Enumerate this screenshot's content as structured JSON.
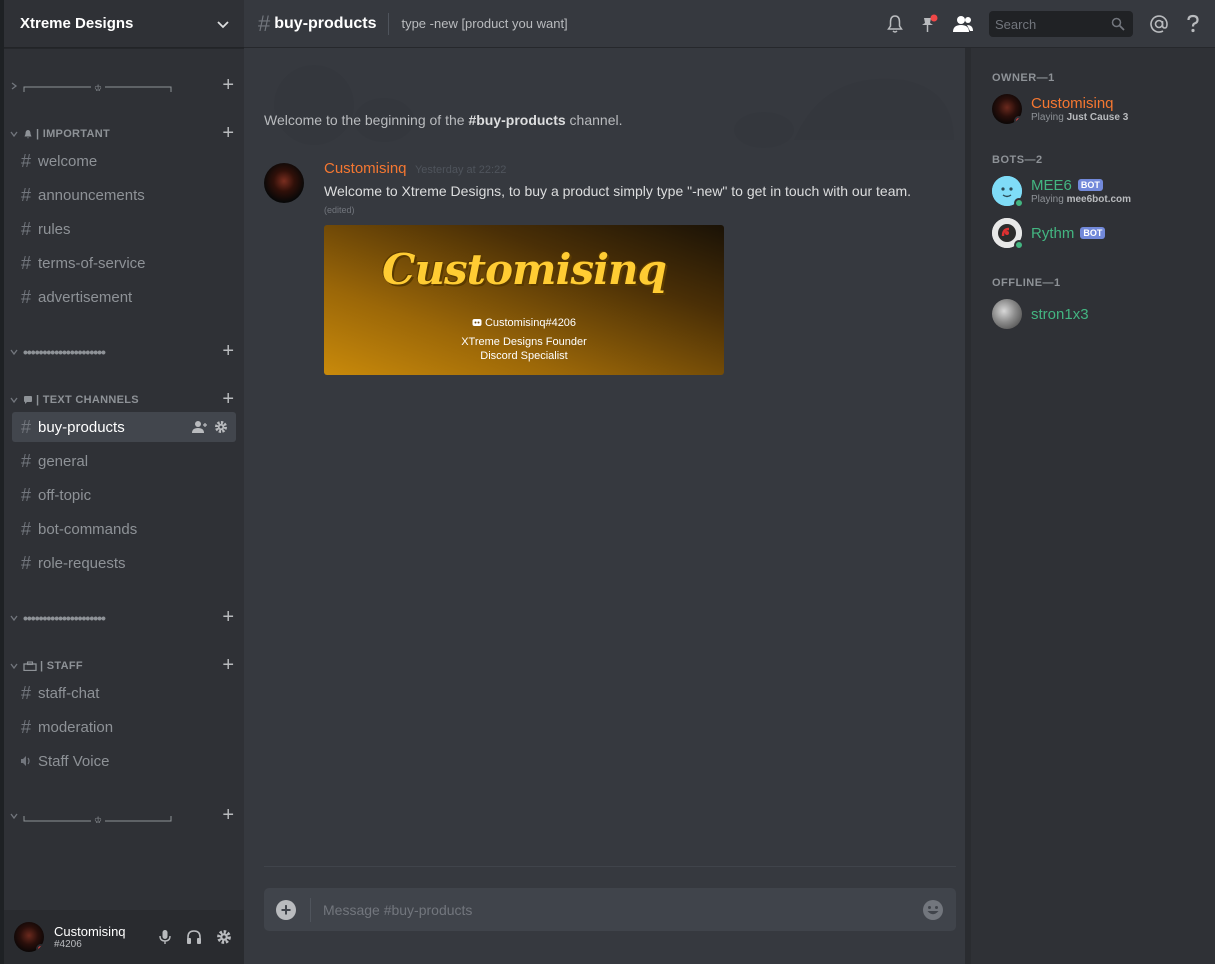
{
  "guild": {
    "name": "Xtreme Designs"
  },
  "categories": {
    "divider_top": {
      "label": ""
    },
    "important": {
      "label": "| IMPORTANT"
    },
    "dots_1": {
      "label": "•••••••••••••••••••••"
    },
    "text_channels": {
      "label": "| TEXT CHANNELS"
    },
    "dots_2": {
      "label": "•••••••••••••••••••••"
    },
    "staff": {
      "label": "| STAFF"
    },
    "divider_bottom": {
      "label": ""
    }
  },
  "channels": {
    "important": [
      "welcome",
      "announcements",
      "rules",
      "terms-of-service",
      "advertisement"
    ],
    "text": [
      "buy-products",
      "general",
      "off-topic",
      "bot-commands",
      "role-requests"
    ],
    "staff": [
      "staff-chat",
      "moderation",
      "Staff Voice"
    ]
  },
  "current_channel": {
    "name": "buy-products",
    "topic": "type -new [product you want]"
  },
  "search": {
    "placeholder": "Search"
  },
  "welcome": {
    "prefix": "Welcome to the beginning of the ",
    "channel": "#buy-products",
    "suffix": " channel."
  },
  "message": {
    "author": "Customisinq",
    "timestamp": "Yesterday at 22:22",
    "text": "Welcome to Xtreme Designs, to buy a product simply type \"-new\" to get in touch with our team.",
    "edited": "(edited)",
    "embed": {
      "logo_text": "Customisinq",
      "tag": "Customisinq#4206",
      "line1": "XTreme Designs Founder",
      "line2": "Discord Specialist"
    }
  },
  "composer": {
    "placeholder": "Message #buy-products"
  },
  "user_panel": {
    "name": "Customisinq",
    "discriminator": "#4206"
  },
  "members": {
    "owner_header": "OWNER—1",
    "bots_header": "BOTS—2",
    "offline_header": "OFFLINE—1",
    "owner": {
      "name": "Customisinq",
      "activity_prefix": "Playing ",
      "activity": "Just Cause 3",
      "color": "#f57731"
    },
    "bots": [
      {
        "name": "MEE6",
        "tag": "BOT",
        "activity_prefix": "Playing ",
        "activity": "mee6bot.com",
        "color": "#43b581"
      },
      {
        "name": "Rythm",
        "tag": "BOT",
        "color": "#43b581"
      }
    ],
    "offline": [
      {
        "name": "stron1x3",
        "color": "#43b581"
      }
    ]
  },
  "colors": {
    "accent_orange": "#f57731",
    "online_green": "#43b581",
    "dnd_red": "#f04747",
    "bot_blurple": "#7289da"
  }
}
